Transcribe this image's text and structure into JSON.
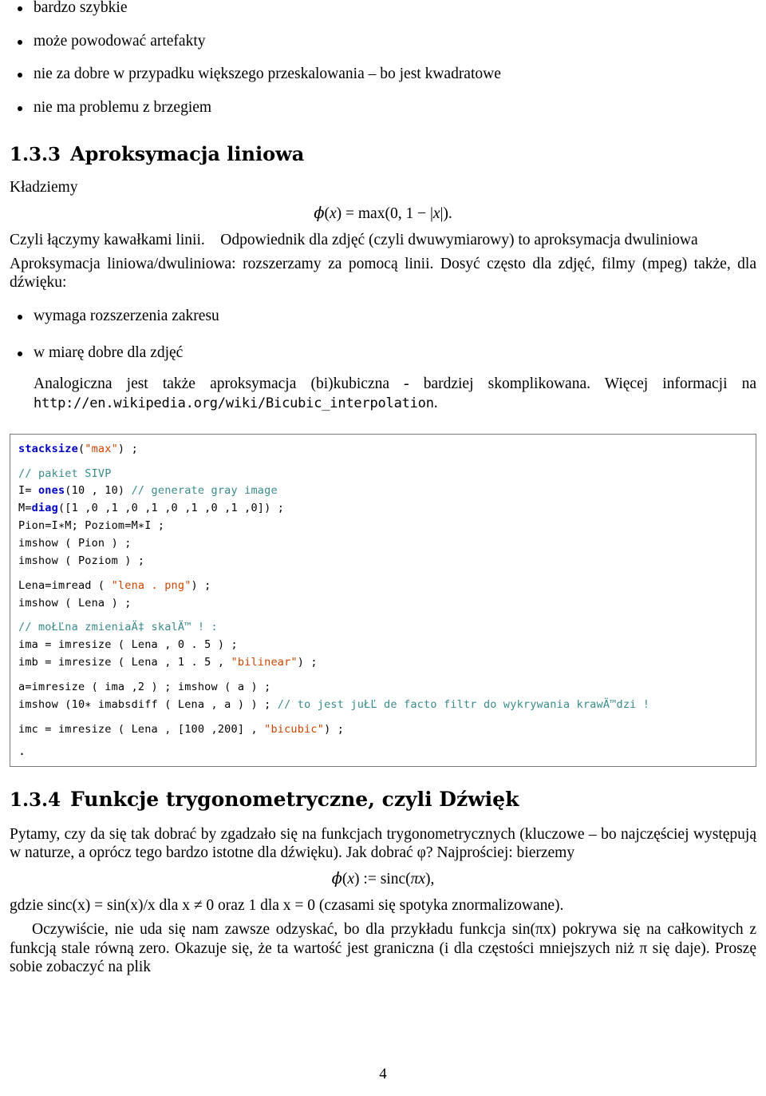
{
  "top_bullets": [
    "bardzo szybkie",
    "może powodować artefakty",
    "nie za dobre w przypadku większego przeskalowania – bo jest kwadratowe",
    "nie ma problemu z brzegiem"
  ],
  "section_linear": {
    "number": "1.3.3",
    "title": "Aproksymacja liniowa",
    "intro": "Kładziemy",
    "formula": "φ(x) = max(0, 1 − |x|).",
    "para1_a": "Czyli łączymy kawałkami linii.",
    "para1_b": "Odpowiednik dla zdjęć (czyli dwuwymiarowy) to aproksymacja dwuliniowa",
    "para2": "Aproksymacja liniowa/dwuliniowa: rozszerzamy za pomocą linii. Dosyć często dla zdjęć, filmy (mpeg) także, dla dźwięku:",
    "bullets": [
      "wymaga rozszerzenia zakresu",
      "w miarę dobre dla zdjęć"
    ],
    "para3_a": "Analogiczna jest także aproksymacja (bi)kubiczna - bardziej skomplikowana. Więcej informacji na ",
    "para3_url": "http://en.wikipedia.org/wiki/Bicubic_interpolation",
    "para3_b": "."
  },
  "code": {
    "lines": [
      [
        {
          "t": "stacksize",
          "c": "kw"
        },
        {
          "t": "(",
          "c": ""
        },
        {
          "t": "\"max\"",
          "c": "str"
        },
        {
          "t": ") ;",
          "c": ""
        }
      ],
      [],
      [
        {
          "t": "// pakiet SIVP",
          "c": "cmt"
        }
      ],
      [
        {
          "t": "I= ",
          "c": ""
        },
        {
          "t": "ones",
          "c": "kw"
        },
        {
          "t": "(10 , 10) ",
          "c": ""
        },
        {
          "t": "// generate gray image",
          "c": "cmt"
        }
      ],
      [
        {
          "t": "M=",
          "c": ""
        },
        {
          "t": "diag",
          "c": "kw"
        },
        {
          "t": "([1 ,0 ,1 ,0 ,1 ,0 ,1 ,0 ,1 ,0]) ;",
          "c": ""
        }
      ],
      [
        {
          "t": "Pion=I∗M; Poziom=M∗I ;",
          "c": ""
        }
      ],
      [
        {
          "t": "imshow ( Pion ) ;",
          "c": ""
        }
      ],
      [
        {
          "t": "imshow ( Poziom ) ;",
          "c": ""
        }
      ],
      [],
      [
        {
          "t": "Lena=imread ( ",
          "c": ""
        },
        {
          "t": "\"lena . png\"",
          "c": "str"
        },
        {
          "t": ") ;",
          "c": ""
        }
      ],
      [
        {
          "t": "imshow ( Lena ) ;",
          "c": ""
        }
      ],
      [],
      [
        {
          "t": "// moŁĽna zmieniaÄ‡ skalÄ™ ! :",
          "c": "cmt"
        }
      ],
      [
        {
          "t": "ima = imresize ( Lena , 0 . 5 ) ;",
          "c": ""
        }
      ],
      [
        {
          "t": "imb = imresize ( Lena , 1 . 5 , ",
          "c": ""
        },
        {
          "t": "\"bilinear\"",
          "c": "str"
        },
        {
          "t": ") ;",
          "c": ""
        }
      ],
      [],
      [
        {
          "t": "a=imresize ( ima ,2 ) ; imshow ( a ) ;",
          "c": ""
        }
      ],
      [
        {
          "t": "imshow (10∗ imabsdiff ( Lena , a ) ) ; ",
          "c": ""
        },
        {
          "t": "// to jest juŁĽ de facto filtr do wykrywania krawÄ™dzi !",
          "c": "cmt"
        }
      ],
      [],
      [
        {
          "t": "imc = imresize ( Lena , [100 ,200] , ",
          "c": ""
        },
        {
          "t": "\"bicubic\"",
          "c": "str"
        },
        {
          "t": ") ;",
          "c": ""
        }
      ]
    ],
    "trailing_dot": "."
  },
  "section_trig": {
    "number": "1.3.4",
    "title": "Funkcje trygonometryczne, czyli Dźwięk",
    "para1": "Pytamy, czy da się tak dobrać by zgadzało się na funkcjach trygonometrycznych (kluczowe – bo najczęściej występują w naturze, a oprócz tego bardzo istotne dla dźwięku). Jak dobrać φ? Najprościej: bierzemy",
    "formula": "φ(x) := sinc(πx),",
    "para2": "gdzie sinc(x) = sin(x)/x dla x ≠ 0 oraz 1 dla x = 0 (czasami się spotyka znormalizowane).",
    "para3": "Oczywiście, nie uda się nam zawsze odzyskać, bo dla przykładu funkcja sin(πx) pokrywa się na całkowitych z funkcją stale równą zero. Okazuje się, że ta wartość jest graniczna (i dla częstości mniejszych niż π się daje). Proszę sobie zobaczyć na plik"
  },
  "page_number": "4"
}
